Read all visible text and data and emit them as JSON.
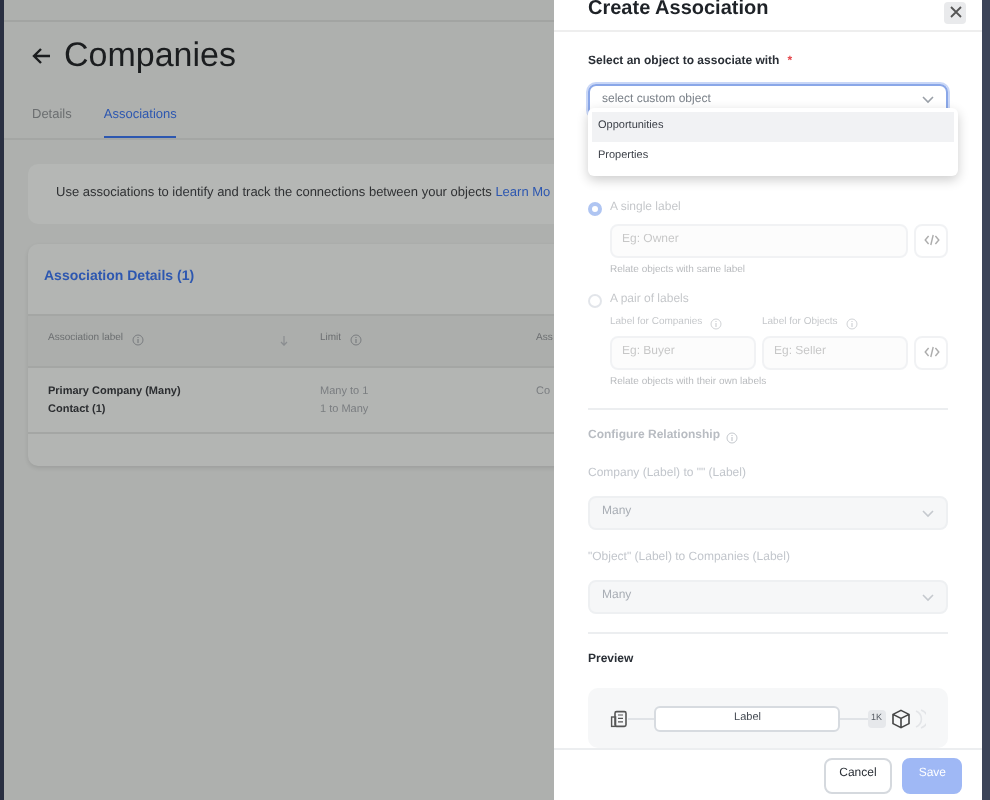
{
  "page": {
    "title": "Companies",
    "tabs": [
      {
        "label": "Details",
        "selected": false
      },
      {
        "label": "Associations",
        "selected": true
      }
    ],
    "info": {
      "text": "Use associations to identify and track the connections between your objects",
      "link": "Learn Mo"
    },
    "card": {
      "title": "Association Details (1)",
      "columns": [
        {
          "label": "Association label",
          "info": true,
          "sortable": true
        },
        {
          "label": "Limit",
          "info": true,
          "sortable": false
        },
        {
          "label": "Ass"
        }
      ],
      "rows": [
        {
          "cells": [
            [
              "Primary Company (Many)",
              "Contact (1)"
            ],
            [
              "Many to 1",
              "1 to Many"
            ],
            [
              "Co"
            ]
          ]
        }
      ]
    }
  },
  "drawer": {
    "title": "Create Association",
    "object_field": {
      "label": "Select an object to associate with",
      "required_mark": "*",
      "placeholder": "select custom object",
      "focused": true,
      "options": [
        {
          "label": "Opportunities",
          "selected": true
        },
        {
          "label": "Properties",
          "selected": false
        }
      ]
    },
    "label_types": [
      {
        "label": "A single label",
        "selected": true,
        "disabled": true,
        "fields": [
          {
            "placeholder": "Eg: Owner"
          }
        ],
        "hint": "Relate objects with same label"
      },
      {
        "label": "A pair of labels",
        "selected": false,
        "disabled": true,
        "fields": [
          {
            "label": "Label for Companies",
            "placeholder": "Eg: Buyer"
          },
          {
            "label": "Label for Objects",
            "placeholder": "Eg: Seller"
          }
        ],
        "hint": "Relate objects with their own labels"
      }
    ],
    "relationship": {
      "title": "Configure Relationship",
      "selects": [
        {
          "label": "Company (Label) to \"\" (Label)",
          "value": "Many",
          "disabled": true
        },
        {
          "label": "\"Object\" (Label) to Companies (Label)",
          "value": "Many",
          "disabled": true
        }
      ]
    },
    "preview": {
      "title": "Preview",
      "label": "Label",
      "count": "1K"
    },
    "buttons": [
      {
        "label": "Cancel",
        "kind": "secondary",
        "disabled": false
      },
      {
        "label": "Save",
        "kind": "primary",
        "disabled": true
      }
    ]
  }
}
